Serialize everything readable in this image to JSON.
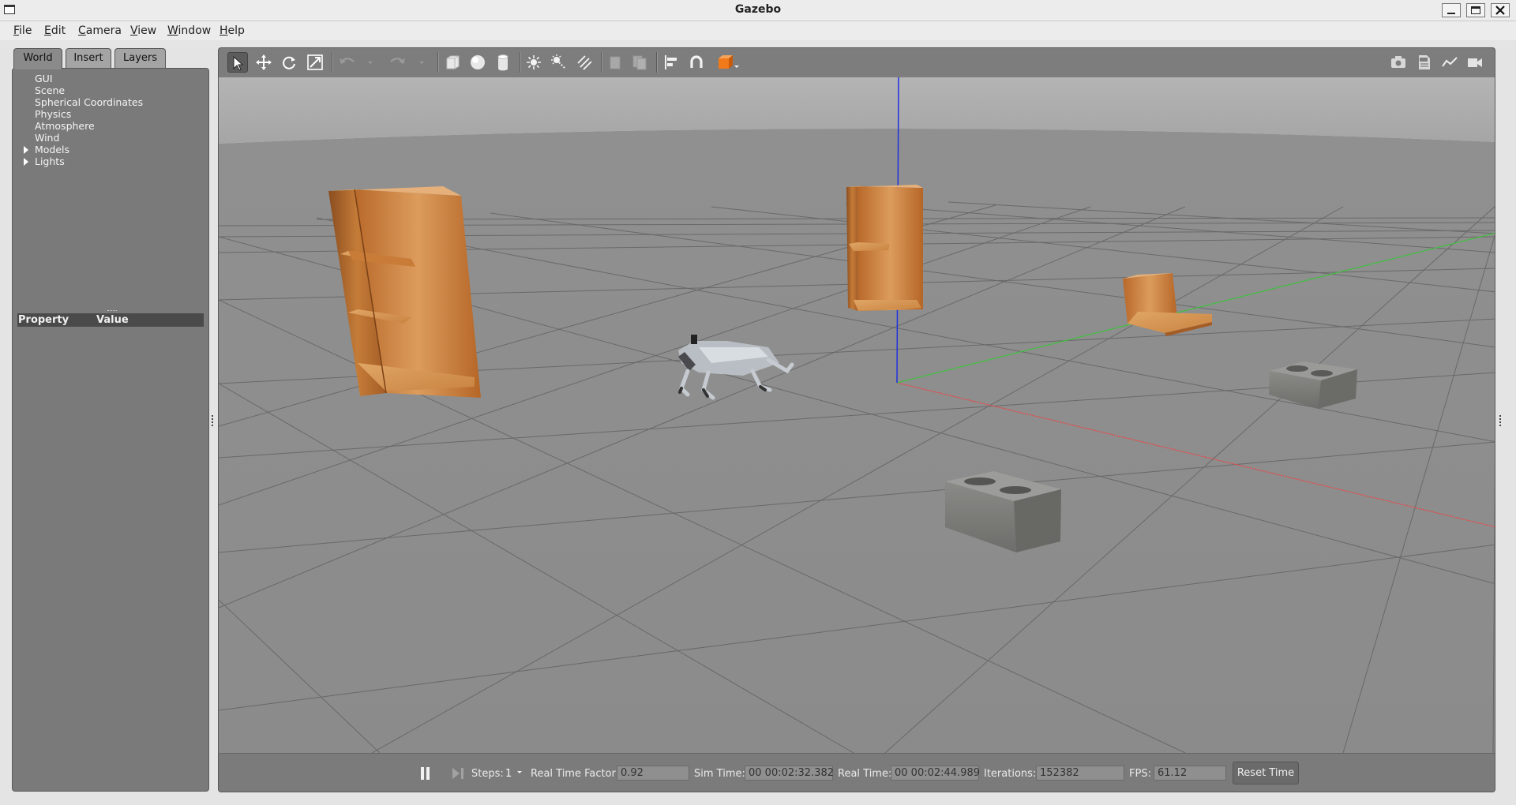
{
  "window": {
    "title": "Gazebo"
  },
  "menu": [
    "File",
    "Edit",
    "Camera",
    "View",
    "Window",
    "Help"
  ],
  "left_panel": {
    "tabs": [
      "World",
      "Insert",
      "Layers"
    ],
    "active_tab": "World",
    "tree": [
      {
        "label": "GUI",
        "expandable": false
      },
      {
        "label": "Scene",
        "expandable": false
      },
      {
        "label": "Spherical Coordinates",
        "expandable": false
      },
      {
        "label": "Physics",
        "expandable": false
      },
      {
        "label": "Atmosphere",
        "expandable": false
      },
      {
        "label": "Wind",
        "expandable": false
      },
      {
        "label": "Models",
        "expandable": true
      },
      {
        "label": "Lights",
        "expandable": true
      }
    ],
    "property_header": {
      "property": "Property",
      "value": "Value"
    }
  },
  "toolbar": {
    "tools": [
      "select-arrow-icon",
      "translate-icon",
      "rotate-icon",
      "scale-icon",
      "undo-icon",
      "redo-icon",
      "box-icon",
      "sphere-icon",
      "cylinder-icon",
      "point-light-icon",
      "spot-light-icon",
      "directional-light-icon",
      "copy-icon",
      "paste-icon",
      "align-icon",
      "snap-icon",
      "view-angle-icon",
      "screenshot-icon",
      "log-icon",
      "plot-icon",
      "video-record-icon"
    ],
    "active_tool": "select-arrow-icon"
  },
  "bottom_bar": {
    "steps_label": "Steps:",
    "steps_value": "1",
    "real_time_factor_label": "Real Time Factor:",
    "real_time_factor": "0.92",
    "sim_time_label": "Sim Time:",
    "sim_time": "00 00:02:32.382",
    "real_time_label": "Real Time:",
    "real_time": "00 00:02:44.989",
    "iterations_label": "Iterations:",
    "iterations": "152382",
    "fps_label": "FPS:",
    "fps": "61.12",
    "reset_time_label": "Reset Time"
  },
  "colors": {
    "ground": "#8d8d8d",
    "sky": "#b4b4b4",
    "wood": "#c0752f",
    "cinder": "#7d7d7b",
    "x_axis": "#e05050",
    "y_axis": "#3fc03f",
    "z_axis": "#2030e0"
  }
}
